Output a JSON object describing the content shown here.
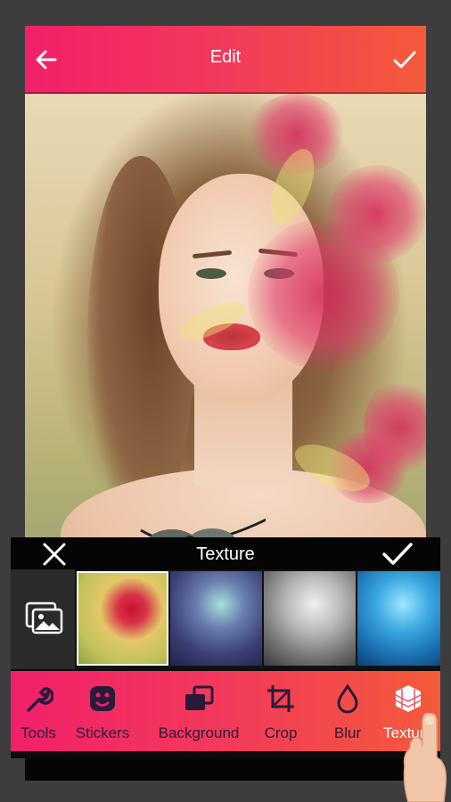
{
  "header": {
    "title": "Edit"
  },
  "texture_panel": {
    "title": "Texture"
  },
  "thumbnails": [
    {
      "name": "texture-red-flower",
      "selected": true
    },
    {
      "name": "texture-purple-flower",
      "selected": false
    },
    {
      "name": "texture-grey-flower",
      "selected": false
    },
    {
      "name": "texture-blue-flower",
      "selected": false
    }
  ],
  "toolbar": {
    "items": [
      {
        "label": "Tools",
        "icon": "wrench-icon"
      },
      {
        "label": "Stickers",
        "icon": "sticker-icon"
      },
      {
        "label": "Background",
        "icon": "background-icon"
      },
      {
        "label": "Crop",
        "icon": "crop-icon"
      },
      {
        "label": "Blur",
        "icon": "blur-icon"
      },
      {
        "label": "Texture",
        "icon": "texture-icon",
        "active": true
      }
    ]
  },
  "colors": {
    "accent_start": "#f2206a",
    "accent_end": "#f45a3a",
    "icon_dark": "#2a1a3a"
  }
}
